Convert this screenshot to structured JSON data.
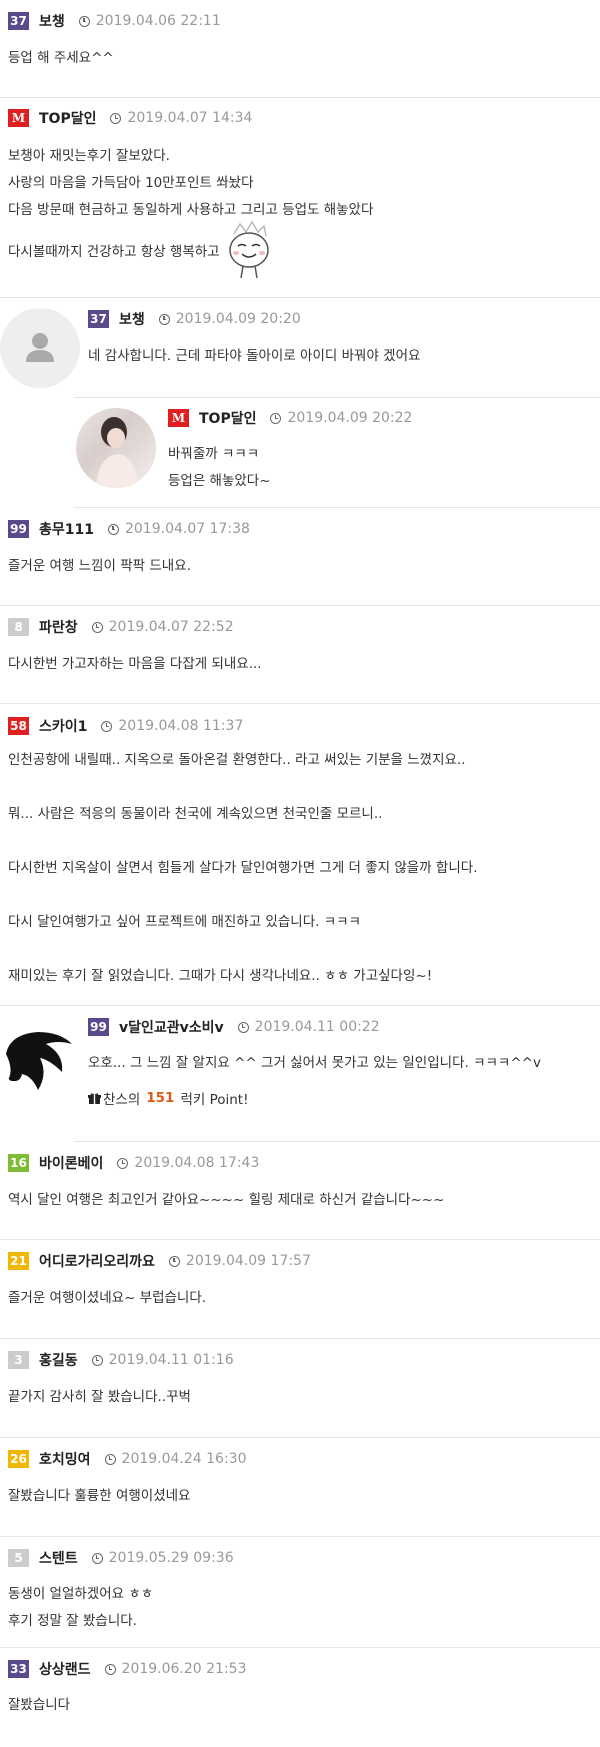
{
  "colors": {
    "purple": "#5a4a8c",
    "red": "#e02020",
    "gray": "#cccccc",
    "green": "#7cbd35",
    "yellow": "#f2b705",
    "orange": "#e15a12"
  },
  "comments": [
    {
      "level": "37",
      "nick": "보챙",
      "date": "2019.04.06 22:11",
      "lines": [
        "등업 해 주세요^^"
      ]
    },
    {
      "level": "M",
      "nick": "TOP달인",
      "date": "2019.04.07 14:34",
      "lines": [
        "보챙아 재밋는후기 잘보았다.",
        "사랑의 마음을 가득담아 10만포인트 쏴놨다",
        "다음 방문때 현금하고 동일하게 사용하고 그리고 등업도 해놓았다",
        "다시볼때까지 건강하고 항상 행복하고"
      ]
    },
    {
      "level": "37",
      "nick": "보챙",
      "date": "2019.04.09 20:20",
      "lines": [
        "네 감사합니다. 근데 파타야 돌아이로 아이디 바꿔야 겠어요"
      ]
    },
    {
      "level": "M",
      "nick": "TOP달인",
      "date": "2019.04.09 20:22",
      "lines": [
        "바꿔줄까 ㅋㅋㅋ",
        "등업은 해놓았다~"
      ]
    },
    {
      "level": "99",
      "nick": "총무111",
      "date": "2019.04.07 17:38",
      "lines": [
        "즐거운 여행 느낌이 팍팍 드내요."
      ]
    },
    {
      "level": "8",
      "nick": "파란창",
      "date": "2019.04.07 22:52",
      "lines": [
        "다시한번 가고자하는 마음을 다잡게 되내요..."
      ]
    },
    {
      "level": "58",
      "nick": "스카이1",
      "date": "2019.04.08 11:37",
      "lines": [
        "인천공항에 내릴때.. 지옥으로 돌아온걸 환영한다.. 라고 써있는 기분을 느꼈지요..",
        "뭐... 사람은 적응의 동물이라 천국에 계속있으면 천국인줄 모르니..",
        "다시한번 지옥살이 살면서 힘들게 살다가 달인여행가면 그게 더 좋지 않을까 합니다.",
        "다시 달인여행가고 싶어 프로젝트에 매진하고 있습니다. ㅋㅋㅋ",
        "재미있는 후기  잘 읽었습니다.   그때가 다시 생각나네요.. ㅎㅎ 가고싶다잉~!"
      ]
    },
    {
      "level": "99",
      "nick": "v달인교관v소비v",
      "date": "2019.04.11 00:22",
      "lines": [
        "오호... 그 느낌 잘 알지요 ^^ 그거 싫어서 못가고 있는 일인입니다. ㅋㅋㅋ^^v"
      ],
      "lucky_pre": "찬스의",
      "lucky_num": "151",
      "lucky_post": "럭키 Point!"
    },
    {
      "level": "16",
      "nick": "바이론베이",
      "date": "2019.04.08 17:43",
      "lines": [
        "역시 달인 여행은 최고인거 같아요~~~~ 힐링 제대로 하신거 같습니다~~~"
      ]
    },
    {
      "level": "21",
      "nick": "어디로가리오리까요",
      "date": "2019.04.09 17:57",
      "lines": [
        "즐거운 여행이셨네요~ 부럽습니다."
      ]
    },
    {
      "level": "3",
      "nick": "홍길동",
      "date": "2019.04.11 01:16",
      "lines": [
        "끝가지 감사히 잘 봤습니다..꾸벅"
      ]
    },
    {
      "level": "26",
      "nick": "호치밍여",
      "date": "2019.04.24 16:30",
      "lines": [
        "잘봤습니다   훌륭한   여행이셨네요"
      ]
    },
    {
      "level": "5",
      "nick": "스텐트",
      "date": "2019.05.29 09:36",
      "lines": [
        "동생이 얼얼하겠어요 ㅎㅎ",
        "후기 정말 잘 봤습니다."
      ]
    },
    {
      "level": "33",
      "nick": "상상랜드",
      "date": "2019.06.20 21:53",
      "lines": [
        "잘봤습니다"
      ]
    }
  ]
}
